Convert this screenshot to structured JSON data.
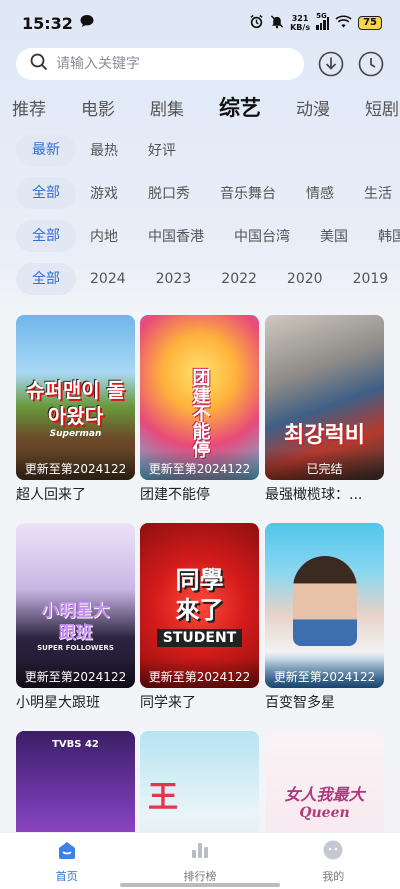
{
  "status": {
    "time": "15:32",
    "net_speed": "321",
    "net_unit": "KB/s",
    "net_type": "5G",
    "battery": "75"
  },
  "search": {
    "placeholder": "请输入关键字"
  },
  "main_tabs": [
    "推荐",
    "电影",
    "剧集",
    "综艺",
    "动漫",
    "短剧"
  ],
  "active_main_tab": "综艺",
  "sort_filters": [
    "最新",
    "最热",
    "好评"
  ],
  "genre_filters": [
    "全部",
    "游戏",
    "脱口秀",
    "音乐舞台",
    "情感",
    "生活"
  ],
  "region_filters": [
    "全部",
    "内地",
    "中国香港",
    "中国台湾",
    "美国",
    "韩国"
  ],
  "year_filters": [
    "全部",
    "2024",
    "2023",
    "2022",
    "2020",
    "2019"
  ],
  "cards": [
    {
      "title": "超人回来了",
      "update": "更新至第2024122",
      "art_text": "슈퍼맨이 돌아왔다",
      "art_sub": "Superman"
    },
    {
      "title": "团建不能停",
      "update": "更新至第2024122",
      "art_text": "团建不能停",
      "art_sub": ""
    },
    {
      "title": "最强橄榄球：...",
      "update": "已完结",
      "art_text": "최강럭비",
      "art_sub": ""
    },
    {
      "title": "小明星大跟班",
      "update": "更新至第2024122",
      "art_text": "小明星大跟班",
      "art_sub": "SUPER FOLLOWERS"
    },
    {
      "title": "同学来了",
      "update": "更新至第2024122",
      "art_text": "同學來了",
      "art_sub": "STUDENT"
    },
    {
      "title": "百变智多星",
      "update": "更新至第2024122",
      "art_text": "",
      "art_sub": ""
    },
    {
      "title": "",
      "update": "",
      "art_text": "",
      "art_sub": "TVBS 42"
    },
    {
      "title": "",
      "update": "",
      "art_text": "王",
      "art_sub": ""
    },
    {
      "title": "",
      "update": "",
      "art_text": "女人我最大",
      "art_sub": "Queen"
    }
  ],
  "bottom_nav": [
    {
      "label": "首页",
      "icon": "home-icon"
    },
    {
      "label": "排行榜",
      "icon": "ranking-icon"
    },
    {
      "label": "我的",
      "icon": "profile-icon"
    }
  ],
  "colors": {
    "accent": "#2f6fd1",
    "chip_bg": "#e2e8f3"
  }
}
